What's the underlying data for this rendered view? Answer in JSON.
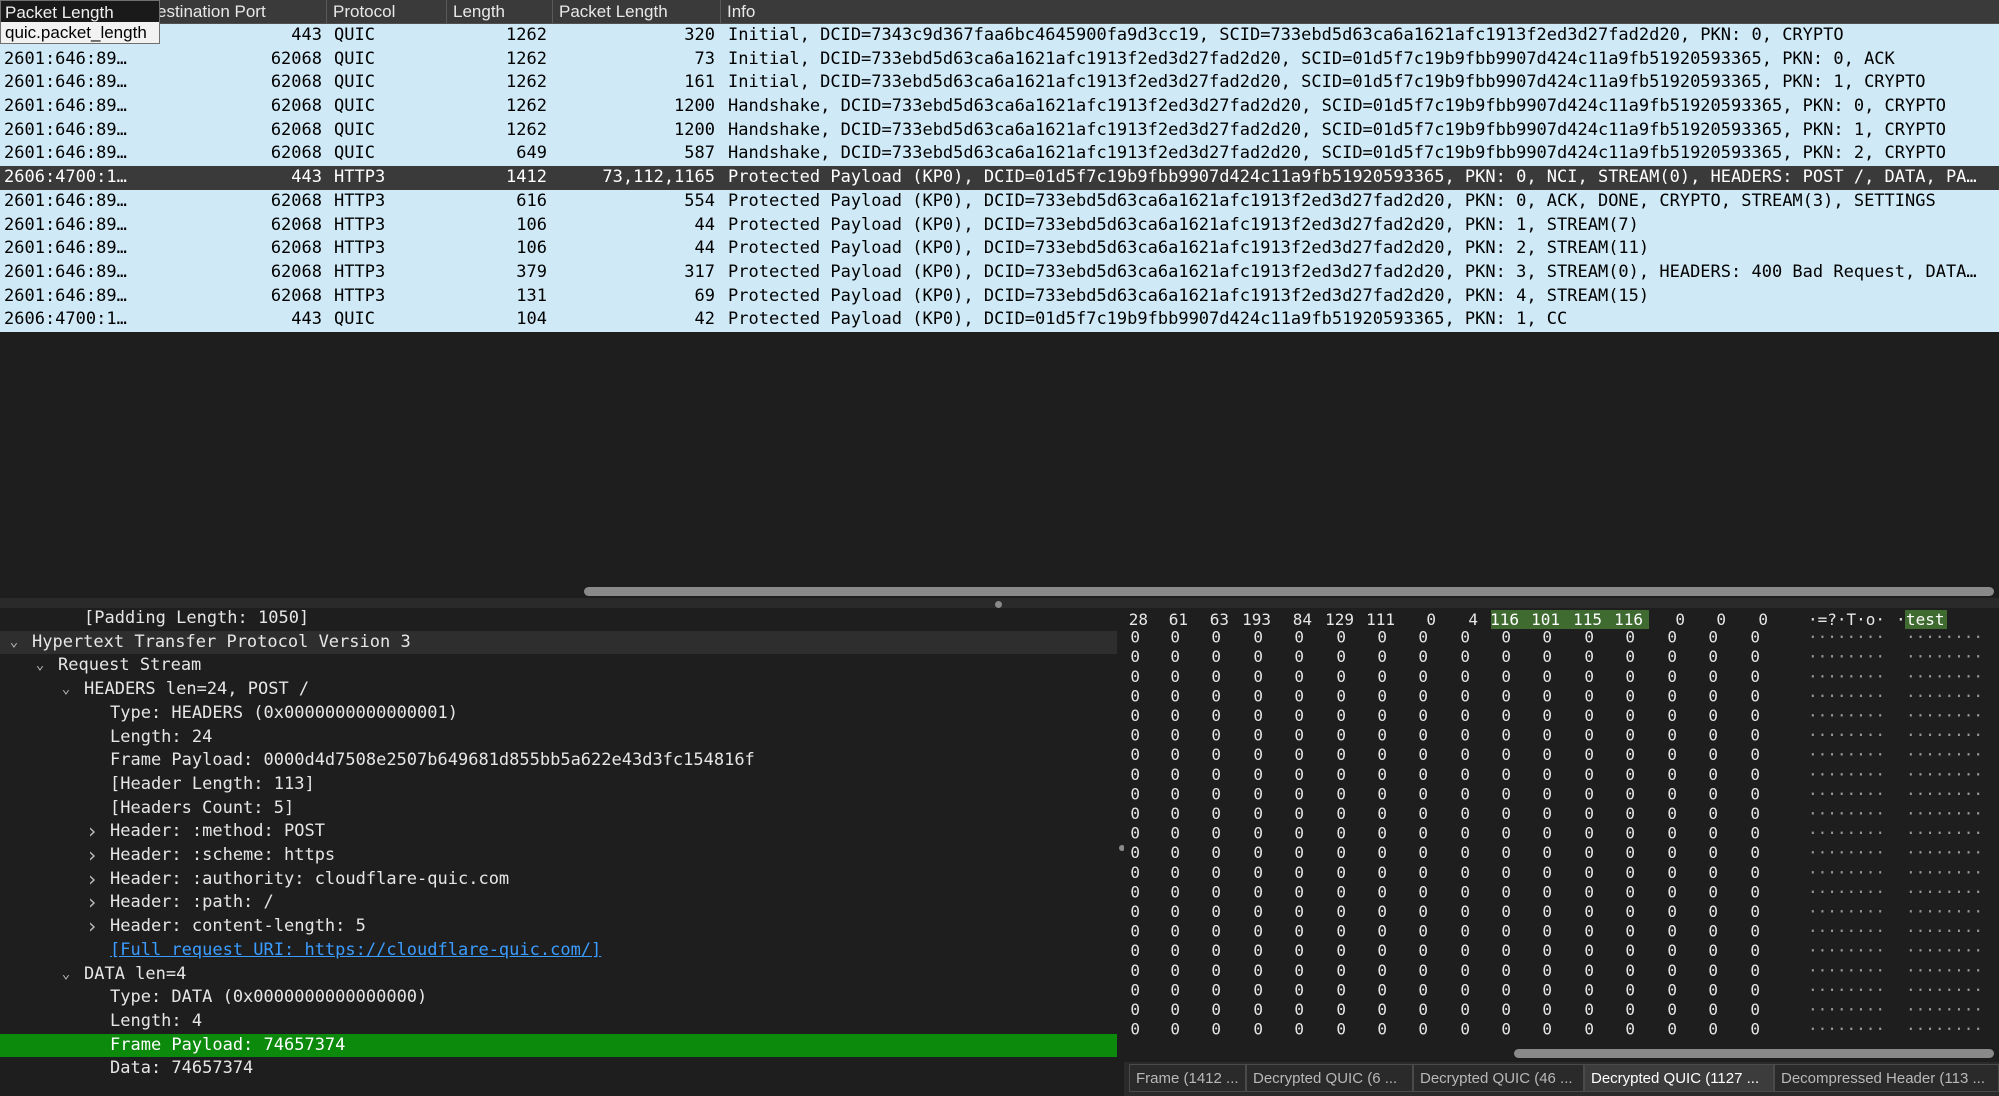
{
  "tooltip": {
    "title": "Packet Length",
    "field": "quic.packet_length"
  },
  "columns": {
    "destination_port": "estination Port",
    "protocol": "Protocol",
    "length": "Length",
    "packet_length": "Packet Length",
    "info": "Info"
  },
  "packets": [
    {
      "src": "",
      "dport": "443",
      "proto": "QUIC",
      "len": "1262",
      "plen": "320",
      "info": "Initial, DCID=7343c9d367faa6bc4645900fa9d3cc19, SCID=733ebd5d63ca6a1621afc1913f2ed3d27fad2d20, PKN: 0, CRYPTO"
    },
    {
      "src": "2601:646:89…",
      "dport": "62068",
      "proto": "QUIC",
      "len": "1262",
      "plen": "73",
      "info": "Initial, DCID=733ebd5d63ca6a1621afc1913f2ed3d27fad2d20, SCID=01d5f7c19b9fbb9907d424c11a9fb51920593365, PKN: 0, ACK"
    },
    {
      "src": "2601:646:89…",
      "dport": "62068",
      "proto": "QUIC",
      "len": "1262",
      "plen": "161",
      "info": "Initial, DCID=733ebd5d63ca6a1621afc1913f2ed3d27fad2d20, SCID=01d5f7c19b9fbb9907d424c11a9fb51920593365, PKN: 1, CRYPTO"
    },
    {
      "src": "2601:646:89…",
      "dport": "62068",
      "proto": "QUIC",
      "len": "1262",
      "plen": "1200",
      "info": "Handshake, DCID=733ebd5d63ca6a1621afc1913f2ed3d27fad2d20, SCID=01d5f7c19b9fbb9907d424c11a9fb51920593365, PKN: 0, CRYPTO"
    },
    {
      "src": "2601:646:89…",
      "dport": "62068",
      "proto": "QUIC",
      "len": "1262",
      "plen": "1200",
      "info": "Handshake, DCID=733ebd5d63ca6a1621afc1913f2ed3d27fad2d20, SCID=01d5f7c19b9fbb9907d424c11a9fb51920593365, PKN: 1, CRYPTO"
    },
    {
      "src": "2601:646:89…",
      "dport": "62068",
      "proto": "QUIC",
      "len": "649",
      "plen": "587",
      "info": "Handshake, DCID=733ebd5d63ca6a1621afc1913f2ed3d27fad2d20, SCID=01d5f7c19b9fbb9907d424c11a9fb51920593365, PKN: 2, CRYPTO"
    },
    {
      "src": "2606:4700:1…",
      "dport": "443",
      "proto": "HTTP3",
      "len": "1412",
      "plen": "73,112,1165",
      "info": "Protected Payload (KP0), DCID=01d5f7c19b9fbb9907d424c11a9fb51920593365, PKN: 0, NCI, STREAM(0), HEADERS: POST /, DATA, PA…",
      "selected": true
    },
    {
      "src": "2601:646:89…",
      "dport": "62068",
      "proto": "HTTP3",
      "len": "616",
      "plen": "554",
      "info": "Protected Payload (KP0), DCID=733ebd5d63ca6a1621afc1913f2ed3d27fad2d20, PKN: 0, ACK, DONE, CRYPTO, STREAM(3), SETTINGS"
    },
    {
      "src": "2601:646:89…",
      "dport": "62068",
      "proto": "HTTP3",
      "len": "106",
      "plen": "44",
      "info": "Protected Payload (KP0), DCID=733ebd5d63ca6a1621afc1913f2ed3d27fad2d20, PKN: 1, STREAM(7)"
    },
    {
      "src": "2601:646:89…",
      "dport": "62068",
      "proto": "HTTP3",
      "len": "106",
      "plen": "44",
      "info": "Protected Payload (KP0), DCID=733ebd5d63ca6a1621afc1913f2ed3d27fad2d20, PKN: 2, STREAM(11)"
    },
    {
      "src": "2601:646:89…",
      "dport": "62068",
      "proto": "HTTP3",
      "len": "379",
      "plen": "317",
      "info": "Protected Payload (KP0), DCID=733ebd5d63ca6a1621afc1913f2ed3d27fad2d20, PKN: 3, STREAM(0), HEADERS: 400 Bad Request, DATA…"
    },
    {
      "src": "2601:646:89…",
      "dport": "62068",
      "proto": "HTTP3",
      "len": "131",
      "plen": "69",
      "info": "Protected Payload (KP0), DCID=733ebd5d63ca6a1621afc1913f2ed3d27fad2d20, PKN: 4, STREAM(15)"
    },
    {
      "src": "2606:4700:1…",
      "dport": "443",
      "proto": "QUIC",
      "len": "104",
      "plen": "42",
      "info": "Protected Payload (KP0), DCID=01d5f7c19b9fbb9907d424c11a9fb51920593365, PKN: 1, CC"
    }
  ],
  "details": [
    {
      "text": "[Padding Length: 1050]",
      "level": 3,
      "arrow": ""
    },
    {
      "text": "Hypertext Transfer Protocol Version 3",
      "level": 1,
      "arrow": "down",
      "kind": "header"
    },
    {
      "text": "Request Stream",
      "level": 2,
      "arrow": "down"
    },
    {
      "text": "HEADERS len=24, POST /",
      "level": 3,
      "arrow": "down"
    },
    {
      "text": "Type: HEADERS (0x0000000000000001)",
      "level": 4,
      "arrow": ""
    },
    {
      "text": "Length: 24",
      "level": 4,
      "arrow": ""
    },
    {
      "text": "Frame Payload: 0000d4d7508e2507b649681d855bb5a622e43d3fc154816f",
      "level": 4,
      "arrow": ""
    },
    {
      "text": "[Header Length: 113]",
      "level": 4,
      "arrow": ""
    },
    {
      "text": "[Headers Count: 5]",
      "level": 4,
      "arrow": ""
    },
    {
      "text": "Header: :method: POST",
      "level": 4,
      "arrow": "right"
    },
    {
      "text": "Header: :scheme: https",
      "level": 4,
      "arrow": "right"
    },
    {
      "text": "Header: :authority: cloudflare-quic.com",
      "level": 4,
      "arrow": "right"
    },
    {
      "text": "Header: :path: /",
      "level": 4,
      "arrow": "right"
    },
    {
      "text": "Header: content-length: 5",
      "level": 4,
      "arrow": "right"
    },
    {
      "text": "[Full request URI: https://cloudflare-quic.com/]",
      "level": 4,
      "arrow": "",
      "kind": "link"
    },
    {
      "text": "DATA len=4",
      "level": 3,
      "arrow": "down"
    },
    {
      "text": "Type: DATA (0x0000000000000000)",
      "level": 4,
      "arrow": ""
    },
    {
      "text": "Length: 4",
      "level": 4,
      "arrow": ""
    },
    {
      "text": "Frame Payload: 74657374",
      "level": 4,
      "arrow": "",
      "kind": "highlight"
    },
    {
      "text": "Data: 74657374",
      "level": 4,
      "arrow": ""
    }
  ],
  "hex": {
    "first_row": [
      "28",
      "61",
      "63",
      "193",
      "84",
      "129",
      "111",
      "0",
      "4",
      "116",
      "101",
      "115",
      "116",
      "0",
      "0",
      "0"
    ],
    "first_row_highlight_from": 9,
    "first_row_highlight_to": 12,
    "first_row_ascii_left": "·=?·T·o·",
    "first_row_ascii_right_dot": "·",
    "first_row_ascii_right_hl": "test",
    "zero_rows": 21,
    "zero_value": "0",
    "zero_ascii": "········",
    "highlight_color": "#3f6b31"
  },
  "byte_tabs": [
    {
      "label": "Frame (1412 ..."
    },
    {
      "label": "Decrypted QUIC (6 ..."
    },
    {
      "label": "Decrypted QUIC (46 ..."
    },
    {
      "label": "Decrypted QUIC (1127 ...",
      "active": true
    },
    {
      "label": "Decompressed Header (113 ..."
    }
  ],
  "colors": {
    "row_bg": "#cfe9f6",
    "selected_row_bg": "#3a3a3a",
    "highlight_green": "#0b8a0b",
    "link": "#3b9cff"
  }
}
